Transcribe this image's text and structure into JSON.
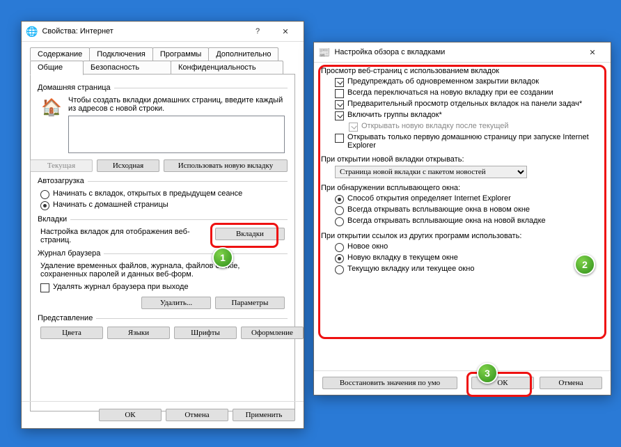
{
  "left": {
    "title": "Свойства: Интернет",
    "tabs_top": [
      "Содержание",
      "Подключения",
      "Программы",
      "Дополнительно"
    ],
    "tabs_bottom": [
      "Общие",
      "Безопасность",
      "Конфиденциальность"
    ],
    "home": {
      "title": "Домашняя страница",
      "desc": "Чтобы создать вкладки домашних страниц, введите каждый из адресов с новой строки.",
      "value": "",
      "btn_current": "Текущая",
      "btn_default": "Исходная",
      "btn_newtab": "Использовать новую вкладку"
    },
    "autostart": {
      "title": "Автозагрузка",
      "opt_lasttabs": "Начинать с вкладок, открытых в предыдущем сеансе",
      "opt_homepage": "Начинать с домашней страницы"
    },
    "tabsgrp": {
      "title": "Вкладки",
      "desc": "Настройка вкладок для отображения веб-страниц.",
      "btn": "Вкладки"
    },
    "history": {
      "title": "Журнал браузера",
      "desc": "Удаление временных файлов, журнала, файлов cookie, сохраненных паролей и данных веб-форм.",
      "chk_onexit": "Удалять журнал браузера при выходе",
      "btn_delete": "Удалить...",
      "btn_params": "Параметры"
    },
    "presentation": {
      "title": "Представление",
      "btn_colors": "Цвета",
      "btn_langs": "Языки",
      "btn_fonts": "Шрифты",
      "btn_style": "Оформление"
    },
    "footer": {
      "ok": "ОК",
      "cancel": "Отмена",
      "apply": "Применить"
    }
  },
  "right": {
    "title": "Настройка обзора с вкладками",
    "browsing": {
      "heading": "Просмотр веб-страниц с использованием вкладок",
      "chk_warnclose": "Предупреждать об одновременном закрытии вкладок",
      "chk_switchnew": "Всегда переключаться на новую вкладку при ее создании",
      "chk_previews": "Предварительный просмотр отдельных вкладок на панели задач*",
      "chk_groups": "Включить группы вкладок*",
      "chk_aftercurrent": "Открывать новую вкладку после текущей",
      "chk_onlyfirst": "Открывать только первую домашнюю страницу при запуске Internet Explorer"
    },
    "newtab": {
      "heading": "При открытии новой вкладки открывать:",
      "selected": "Страница новой вкладки с пакетом новостей"
    },
    "popup": {
      "heading": "При обнаружении всплывающего окна:",
      "opt_ie": "Способ открытия определяет Internet Explorer",
      "opt_newwin": "Всегда открывать всплывающие окна в новом окне",
      "opt_newtab": "Всегда открывать всплывающие окна на новой вкладке"
    },
    "links": {
      "heading": "При открытии ссылок из других программ использовать:",
      "opt_newwin": "Новое окно",
      "opt_curtab": "Новую вкладку в текущем окне",
      "opt_curwin": "Текущую вкладку или текущее окно"
    },
    "footer": {
      "restore": "Восстановить значения по умо",
      "ok": "ОК",
      "cancel": "Отмена"
    }
  },
  "markers": {
    "m1": "1",
    "m2": "2",
    "m3": "3"
  }
}
